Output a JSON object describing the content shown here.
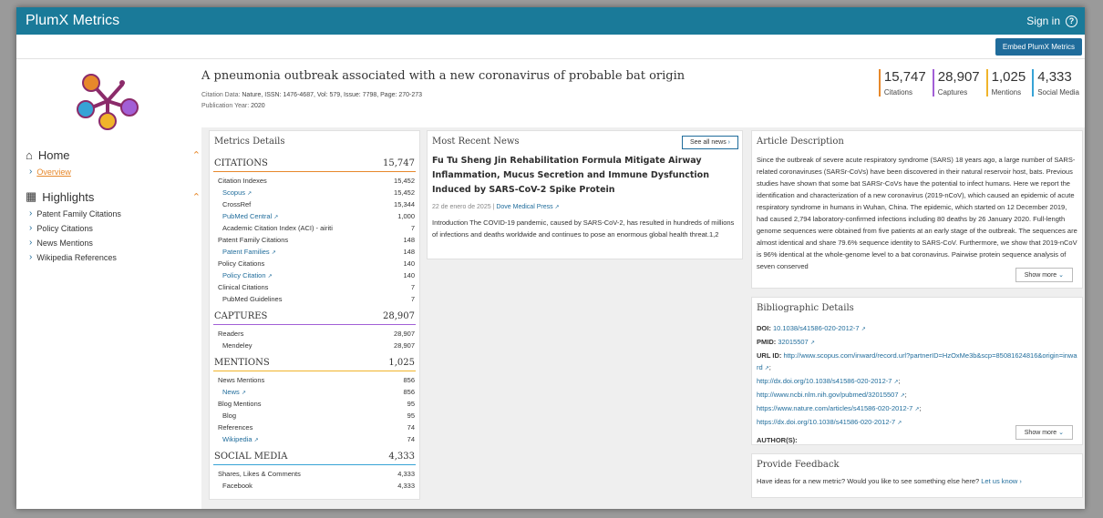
{
  "app": {
    "brand": "PlumX Metrics",
    "sign_in": "Sign in"
  },
  "toolbar": {
    "embed_label": "Embed PlumX Metrics"
  },
  "nav": {
    "sections": [
      {
        "label": "Home",
        "items": [
          {
            "label": "Overview",
            "active": true
          }
        ]
      },
      {
        "label": "Highlights",
        "items": [
          {
            "label": "Patent Family Citations"
          },
          {
            "label": "Policy Citations"
          },
          {
            "label": "News Mentions"
          },
          {
            "label": "Wikipedia References"
          }
        ]
      }
    ]
  },
  "article": {
    "title": "A pneumonia outbreak associated with a new coronavirus of probable bat origin",
    "citation_label": "Citation Data:",
    "citation_value": "Nature, ISSN: 1476-4687, Vol: 579, Issue: 7798, Page: 270-273",
    "pubyear_label": "Publication Year:",
    "pubyear_value": "2020"
  },
  "summary_stats": [
    {
      "value": "15,747",
      "label": "Citations",
      "color": "#e7882b"
    },
    {
      "value": "28,907",
      "label": "Captures",
      "color": "#a25fd6"
    },
    {
      "value": "1,025",
      "label": "Mentions",
      "color": "#f0b42a"
    },
    {
      "value": "4,333",
      "label": "Social Media",
      "color": "#37a3d6"
    }
  ],
  "metrics": {
    "title": "Metrics Details",
    "groups": [
      {
        "name": "CITATIONS",
        "total": "15,747",
        "color": "#e7882b",
        "rows": [
          {
            "label": "Citation Indexes",
            "value": "15,452",
            "level": 1
          },
          {
            "label": "Scopus",
            "value": "15,452",
            "level": 2,
            "link": true
          },
          {
            "label": "CrossRef",
            "value": "15,344",
            "level": 2
          },
          {
            "label": "PubMed Central",
            "value": "1,000",
            "level": 2,
            "link": true
          },
          {
            "label": "Academic Citation Index (ACI) - airiti",
            "value": "7",
            "level": 2
          },
          {
            "label": "Patent Family Citations",
            "value": "148",
            "level": 1
          },
          {
            "label": "Patent Families",
            "value": "148",
            "level": 2,
            "link": true
          },
          {
            "label": "Policy Citations",
            "value": "140",
            "level": 1
          },
          {
            "label": "Policy Citation",
            "value": "140",
            "level": 2,
            "link": true
          },
          {
            "label": "Clinical Citations",
            "value": "7",
            "level": 1
          },
          {
            "label": "PubMed Guidelines",
            "value": "7",
            "level": 2
          }
        ]
      },
      {
        "name": "CAPTURES",
        "total": "28,907",
        "color": "#a25fd6",
        "rows": [
          {
            "label": "Readers",
            "value": "28,907",
            "level": 1
          },
          {
            "label": "Mendeley",
            "value": "28,907",
            "level": 2
          }
        ]
      },
      {
        "name": "MENTIONS",
        "total": "1,025",
        "color": "#f0b42a",
        "rows": [
          {
            "label": "News Mentions",
            "value": "856",
            "level": 1
          },
          {
            "label": "News",
            "value": "856",
            "level": 2,
            "link": true
          },
          {
            "label": "Blog Mentions",
            "value": "95",
            "level": 1
          },
          {
            "label": "Blog",
            "value": "95",
            "level": 2
          },
          {
            "label": "References",
            "value": "74",
            "level": 1
          },
          {
            "label": "Wikipedia",
            "value": "74",
            "level": 2,
            "link": true
          }
        ]
      },
      {
        "name": "SOCIAL MEDIA",
        "total": "4,333",
        "color": "#37a3d6",
        "rows": [
          {
            "label": "Shares, Likes & Comments",
            "value": "4,333",
            "level": 1
          },
          {
            "label": "Facebook",
            "value": "4,333",
            "level": 2
          }
        ]
      }
    ]
  },
  "news": {
    "title": "Most Recent News",
    "see_all": "See all news",
    "headline": "Fu Tu Sheng Jin Rehabilitation Formula Mitigate Airway Inflammation, Mucus Secretion and Immune Dysfunction Induced by SARS-CoV-2 Spike Protein",
    "date": "22 de enero de 2025",
    "source": "Dove Medical Press",
    "body": "Introduction The COVID-19 pandemic, caused by SARS-CoV-2, has resulted in hundreds of millions of infections and deaths worldwide and continues to pose an enormous global health threat.1,2"
  },
  "description": {
    "title": "Article Description",
    "text": "Since the outbreak of severe acute respiratory syndrome (SARS) 18 years ago, a large number of SARS-related coronaviruses (SARSr-CoVs) have been discovered in their natural reservoir host, bats. Previous studies have shown that some bat SARSr-CoVs have the potential to infect humans. Here we report the identification and characterization of a new coronavirus (2019-nCoV), which caused an epidemic of acute respiratory syndrome in humans in Wuhan, China. The epidemic, which started on 12 December 2019, had caused 2,794 laboratory-confirmed infections including 80 deaths by 26 January 2020. Full-length genome sequences were obtained from five patients at an early stage of the outbreak. The sequences are almost identical and share 79.6% sequence identity to SARS-CoV. Furthermore, we show that 2019-nCoV is 96% identical at the whole-genome level to a bat coronavirus. Pairwise protein sequence analysis of seven conserved",
    "show_more": "Show more"
  },
  "biblio": {
    "title": "Bibliographic Details",
    "doi_label": "DOI:",
    "doi": "10.1038/s41586-020-2012-7",
    "pmid_label": "PMID:",
    "pmid": "32015507",
    "url_label": "URL ID:",
    "urls": [
      "http://www.scopus.com/inward/record.url?partnerID=HzOxMe3b&scp=85081624816&origin=inward",
      "http://dx.doi.org/10.1038/s41586-020-2012-7",
      "http://www.ncbi.nlm.nih.gov/pubmed/32015507",
      "https://www.nature.com/articles/s41586-020-2012-7",
      "https://dx.doi.org/10.1038/s41586-020-2012-7"
    ],
    "authors_label": "AUTHOR(S):",
    "show_more": "Show more"
  },
  "feedback": {
    "title": "Provide Feedback",
    "text": "Have ideas for a new metric? Would you like to see something else here?",
    "link": "Let us know"
  }
}
